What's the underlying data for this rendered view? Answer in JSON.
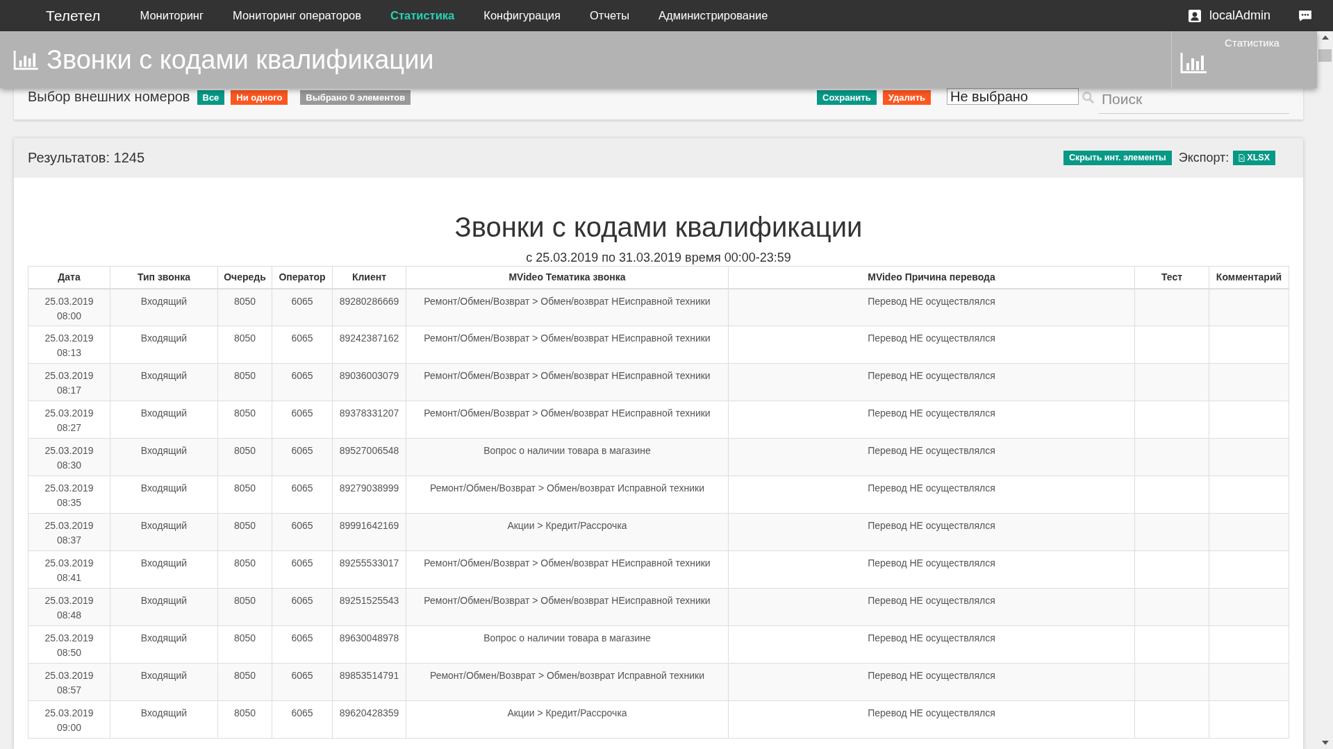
{
  "nav": {
    "brand": "Телетел",
    "items": [
      {
        "label": "Мониторинг",
        "selected": false
      },
      {
        "label": "Мониторинг операторов",
        "selected": false
      },
      {
        "label": "Статистика",
        "selected": true
      },
      {
        "label": "Конфигурация",
        "selected": false
      },
      {
        "label": "Отчеты",
        "selected": false
      },
      {
        "label": "Администрирование",
        "selected": false
      }
    ],
    "user": "localAdmin"
  },
  "header": {
    "title": "Звонки с кодами квалификации",
    "side_label": "Статистика"
  },
  "filter": {
    "label": "Выбор внешних номеров",
    "all_button": "Все",
    "none_button": "Ни одного",
    "selected_count": "Выбрано 0 элементов",
    "save_button": "Сохранить",
    "delete_button": "Удалить",
    "select_value": "Не выбрано",
    "search_placeholder": "Поиск"
  },
  "results": {
    "count": "Результатов: 1245",
    "hide_button": "Скрыть инт. элементы",
    "export_label": "Экспорт:",
    "export_button": "XLSX"
  },
  "report": {
    "title": "Звонки с кодами квалификации",
    "period": "с 25.03.2019 по 31.03.2019 время 00:00-23:59"
  },
  "table": {
    "columns": [
      "Дата",
      "Тип звонка",
      "Очередь",
      "Оператор",
      "Клиент",
      "MVideo Тематика звонка",
      "MVideo Причина перевода",
      "Тест",
      "Комментарий"
    ],
    "rows": [
      [
        "25.03.2019\n08:00",
        "Входящий",
        "8050",
        "6065",
        "89280286669",
        "Ремонт/Обмен/Возврат > Обмен/возврат НЕисправной техники",
        "Перевод НЕ осуществлялся"
      ],
      [
        "25.03.2019\n08:13",
        "Входящий",
        "8050",
        "6065",
        "89242387162",
        "Ремонт/Обмен/Возврат > Обмен/возврат НЕисправной техники",
        "Перевод НЕ осуществлялся"
      ],
      [
        "25.03.2019\n08:17",
        "Входящий",
        "8050",
        "6065",
        "89036003079",
        "Ремонт/Обмен/Возврат > Обмен/возврат НЕисправной техники",
        "Перевод НЕ осуществлялся"
      ],
      [
        "25.03.2019\n08:27",
        "Входящий",
        "8050",
        "6065",
        "89378331207",
        "Ремонт/Обмен/Возврат > Обмен/возврат НЕисправной техники",
        "Перевод НЕ осуществлялся"
      ],
      [
        "25.03.2019\n08:30",
        "Входящий",
        "8050",
        "6065",
        "89527006548",
        "Вопрос о наличии товара в магазине",
        "Перевод НЕ осуществлялся"
      ],
      [
        "25.03.2019\n08:35",
        "Входящий",
        "8050",
        "6065",
        "89279038999",
        "Ремонт/Обмен/Возврат > Обмен/возврат Исправной техники",
        "Перевод НЕ осуществлялся"
      ],
      [
        "25.03.2019\n08:37",
        "Входящий",
        "8050",
        "6065",
        "89991642169",
        "Акции > Кредит/Рассрочка",
        "Перевод НЕ осуществлялся"
      ],
      [
        "25.03.2019\n08:41",
        "Входящий",
        "8050",
        "6065",
        "89255533017",
        "Ремонт/Обмен/Возврат > Обмен/возврат НЕисправной техники",
        "Перевод НЕ осуществлялся"
      ],
      [
        "25.03.2019\n08:48",
        "Входящий",
        "8050",
        "6065",
        "89251525543",
        "Ремонт/Обмен/Возврат > Обмен/возврат НЕисправной техники",
        "Перевод НЕ осуществлялся"
      ],
      [
        "25.03.2019\n08:50",
        "Входящий",
        "8050",
        "6065",
        "89630048978",
        "Вопрос о наличии товара в магазине",
        "Перевод НЕ осуществлялся"
      ],
      [
        "25.03.2019\n08:57",
        "Входящий",
        "8050",
        "6065",
        "89853514791",
        "Ремонт/Обмен/Возврат > Обмен/возврат Исправной техники",
        "Перевод НЕ осуществлялся"
      ],
      [
        "25.03.2019\n09:00",
        "Входящий",
        "8050",
        "6065",
        "89620428359",
        "Акции > Кредит/Рассрочка",
        "Перевод НЕ осуществлялся"
      ]
    ]
  }
}
